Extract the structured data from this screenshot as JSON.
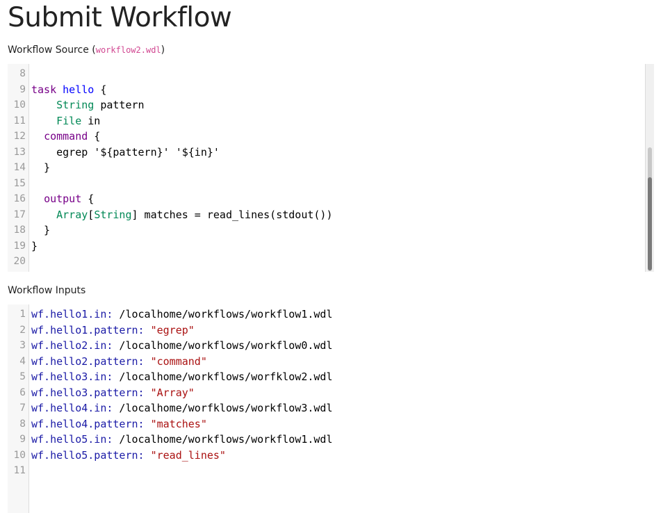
{
  "page": {
    "title": "Submit Workflow"
  },
  "source_section": {
    "label": "Workflow Source (",
    "filename": "workflow2.wdl",
    "label_close": ")",
    "lines": [
      {
        "n": "8",
        "tokens": []
      },
      {
        "n": "9",
        "tokens": [
          {
            "t": "task",
            "c": "kw"
          },
          {
            "t": " "
          },
          {
            "t": "hello",
            "c": "def"
          },
          {
            "t": " {"
          }
        ]
      },
      {
        "n": "10",
        "tokens": [
          {
            "t": "    "
          },
          {
            "t": "String",
            "c": "ty"
          },
          {
            "t": " pattern"
          }
        ]
      },
      {
        "n": "11",
        "tokens": [
          {
            "t": "    "
          },
          {
            "t": "File",
            "c": "ty"
          },
          {
            "t": " in"
          }
        ]
      },
      {
        "n": "12",
        "tokens": [
          {
            "t": "  "
          },
          {
            "t": "command",
            "c": "kw"
          },
          {
            "t": " {"
          }
        ]
      },
      {
        "n": "13",
        "tokens": [
          {
            "t": "    egrep '${pattern}' '${in}'"
          }
        ]
      },
      {
        "n": "14",
        "tokens": [
          {
            "t": "  }"
          }
        ]
      },
      {
        "n": "15",
        "tokens": []
      },
      {
        "n": "16",
        "tokens": [
          {
            "t": "  "
          },
          {
            "t": "output",
            "c": "kw"
          },
          {
            "t": " {"
          }
        ]
      },
      {
        "n": "17",
        "tokens": [
          {
            "t": "    "
          },
          {
            "t": "Array",
            "c": "ty"
          },
          {
            "t": "["
          },
          {
            "t": "String",
            "c": "ty"
          },
          {
            "t": "] matches = read_lines(stdout())"
          }
        ]
      },
      {
        "n": "18",
        "tokens": [
          {
            "t": "  }"
          }
        ]
      },
      {
        "n": "19",
        "tokens": [
          {
            "t": "}"
          }
        ]
      },
      {
        "n": "20",
        "tokens": []
      }
    ]
  },
  "inputs_section": {
    "label": "Workflow Inputs",
    "lines": [
      {
        "n": "1",
        "tokens": [
          {
            "t": "wf.hello1.in:",
            "c": "prop"
          },
          {
            "t": " /localhome/workflows/workflow1.wdl",
            "c": "path"
          }
        ]
      },
      {
        "n": "2",
        "tokens": [
          {
            "t": "wf.hello1.pattern:",
            "c": "prop"
          },
          {
            "t": " "
          },
          {
            "t": "\"egrep\"",
            "c": "str"
          }
        ]
      },
      {
        "n": "3",
        "tokens": [
          {
            "t": "wf.hello2.in:",
            "c": "prop"
          },
          {
            "t": " /localhome/workflows/workflow0.wdl",
            "c": "path"
          }
        ]
      },
      {
        "n": "4",
        "tokens": [
          {
            "t": "wf.hello2.pattern:",
            "c": "prop"
          },
          {
            "t": " "
          },
          {
            "t": "\"command\"",
            "c": "str"
          }
        ]
      },
      {
        "n": "5",
        "tokens": [
          {
            "t": "wf.hello3.in:",
            "c": "prop"
          },
          {
            "t": " /localhome/workflows/worfklow2.wdl",
            "c": "path"
          }
        ]
      },
      {
        "n": "6",
        "tokens": [
          {
            "t": "wf.hello3.pattern:",
            "c": "prop"
          },
          {
            "t": " "
          },
          {
            "t": "\"Array\"",
            "c": "str"
          }
        ]
      },
      {
        "n": "7",
        "tokens": [
          {
            "t": "wf.hello4.in:",
            "c": "prop"
          },
          {
            "t": " /localhome/worfklows/workflow3.wdl",
            "c": "path"
          }
        ]
      },
      {
        "n": "8",
        "tokens": [
          {
            "t": "wf.hello4.pattern:",
            "c": "prop"
          },
          {
            "t": " "
          },
          {
            "t": "\"matches\"",
            "c": "str"
          }
        ]
      },
      {
        "n": "9",
        "tokens": [
          {
            "t": "wf.hello5.in:",
            "c": "prop"
          },
          {
            "t": " /localhome/workflows/workflow1.wdl",
            "c": "path"
          }
        ]
      },
      {
        "n": "10",
        "tokens": [
          {
            "t": "wf.hello5.pattern:",
            "c": "prop"
          },
          {
            "t": " "
          },
          {
            "t": "\"read_lines\"",
            "c": "str"
          }
        ]
      },
      {
        "n": "11",
        "tokens": []
      }
    ]
  }
}
